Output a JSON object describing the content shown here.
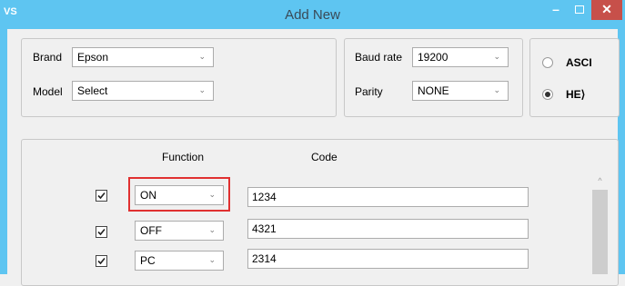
{
  "window": {
    "title": "Add New",
    "app_icon_label": "VS"
  },
  "device": {
    "brand_label": "Brand",
    "brand_value": "Epson",
    "model_label": "Model",
    "model_value": "Select"
  },
  "serial": {
    "baud_label": "Baud rate",
    "baud_value": "19200",
    "parity_label": "Parity",
    "parity_value": "NONE"
  },
  "format": {
    "ascii_label": "ASCI",
    "hex_label": "HE⟩",
    "selected": "hex"
  },
  "table": {
    "headers": {
      "function": "Function",
      "code": "Code"
    },
    "rows": [
      {
        "checked": true,
        "function": "ON",
        "code": "1234"
      },
      {
        "checked": true,
        "function": "OFF",
        "code": "4321"
      },
      {
        "checked": true,
        "function": "PC",
        "code": "2314"
      }
    ]
  },
  "colors": {
    "titlebar": "#5ec5f1",
    "close": "#c7504a",
    "highlight": "#e03030"
  },
  "icons": {
    "dropdown": "chevron-down-icon",
    "check": "checkmark-icon"
  }
}
